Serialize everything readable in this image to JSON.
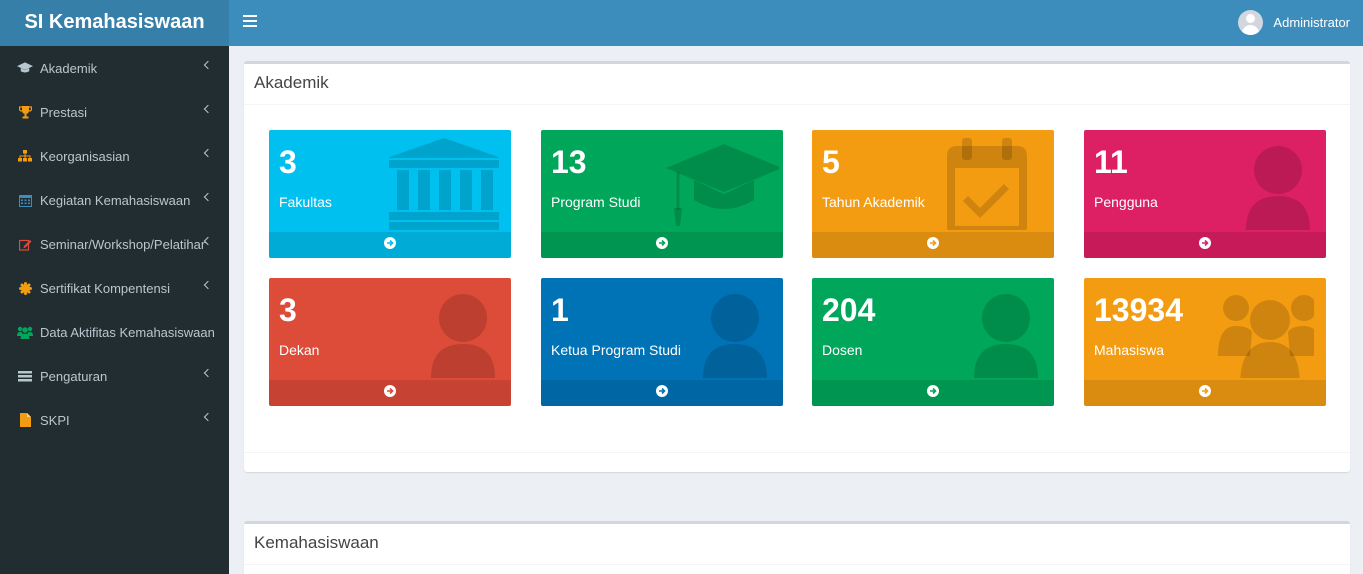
{
  "app": {
    "title": "SI Kemahasiswaan"
  },
  "header": {
    "user_name": "Administrator"
  },
  "sidebar": {
    "items": [
      {
        "label": "Akademik",
        "icon": "graduation-cap-icon"
      },
      {
        "label": "Prestasi",
        "icon": "trophy-icon"
      },
      {
        "label": "Keorganisasian",
        "icon": "sitemap-icon"
      },
      {
        "label": "Kegiatan Kemahasiswaan",
        "icon": "calendar-icon"
      },
      {
        "label": "Seminar/Workshop/Pelatihan",
        "icon": "edit-icon"
      },
      {
        "label": "Sertifikat Kompentensi",
        "icon": "certificate-icon"
      },
      {
        "label": "Data Aktifitas Kemahasiswaan",
        "icon": "users-icon"
      },
      {
        "label": "Pengaturan",
        "icon": "list-icon"
      },
      {
        "label": "SKPI",
        "icon": "file-icon"
      }
    ]
  },
  "sections": {
    "akademik": {
      "title": "Akademik"
    },
    "kemahasiswaan": {
      "title": "Kemahasiswaan"
    }
  },
  "cards": [
    {
      "value": "3",
      "label": "Fakultas",
      "color": "#00c0ef",
      "icon": "institution-icon"
    },
    {
      "value": "13",
      "label": "Program Studi",
      "color": "#00a65a",
      "icon": "graduation-cap-icon"
    },
    {
      "value": "5",
      "label": "Tahun Akademik",
      "color": "#f39c12",
      "icon": "calendar-check-icon"
    },
    {
      "value": "11",
      "label": "Pengguna",
      "color": "#dd1f63",
      "icon": "user-icon"
    },
    {
      "value": "3",
      "label": "Dekan",
      "color": "#dd4b39",
      "icon": "user-icon"
    },
    {
      "value": "1",
      "label": "Ketua Program Studi",
      "color": "#0073b7",
      "icon": "user-icon"
    },
    {
      "value": "204",
      "label": "Dosen",
      "color": "#00a65a",
      "icon": "user-icon"
    },
    {
      "value": "13934",
      "label": "Mahasiswa",
      "color": "#f39c12",
      "icon": "users-icon"
    }
  ]
}
